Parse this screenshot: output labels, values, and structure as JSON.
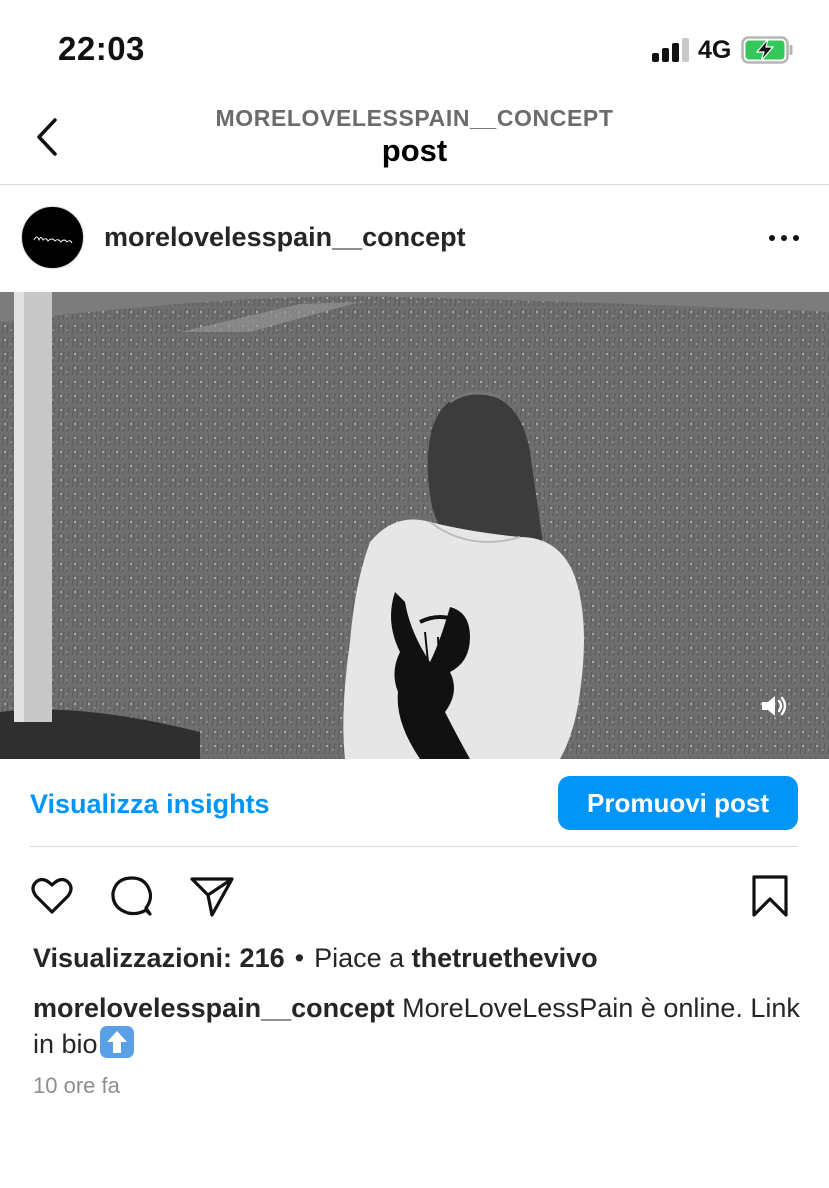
{
  "status_bar": {
    "time": "22:03",
    "network": "4G"
  },
  "header": {
    "account_caps": "MORELOVELESSPAIN__CONCEPT",
    "title": "post"
  },
  "post": {
    "username": "morelovelesspain__concept",
    "avatar_text": "More love less pain",
    "insights_link": "Visualizza insights",
    "promote_button": "Promuovi post",
    "views_label": "Visualizzazioni: 216",
    "liked_prefix": "Piace a",
    "liked_by": "thetruethevivo",
    "caption_user": "morelovelesspain__concept",
    "caption_text": "MoreLoveLessPain è online. Link in bio",
    "time_ago": "10 ore fa"
  },
  "colors": {
    "accent": "#0095f6",
    "battery_fill": "#34c759"
  }
}
